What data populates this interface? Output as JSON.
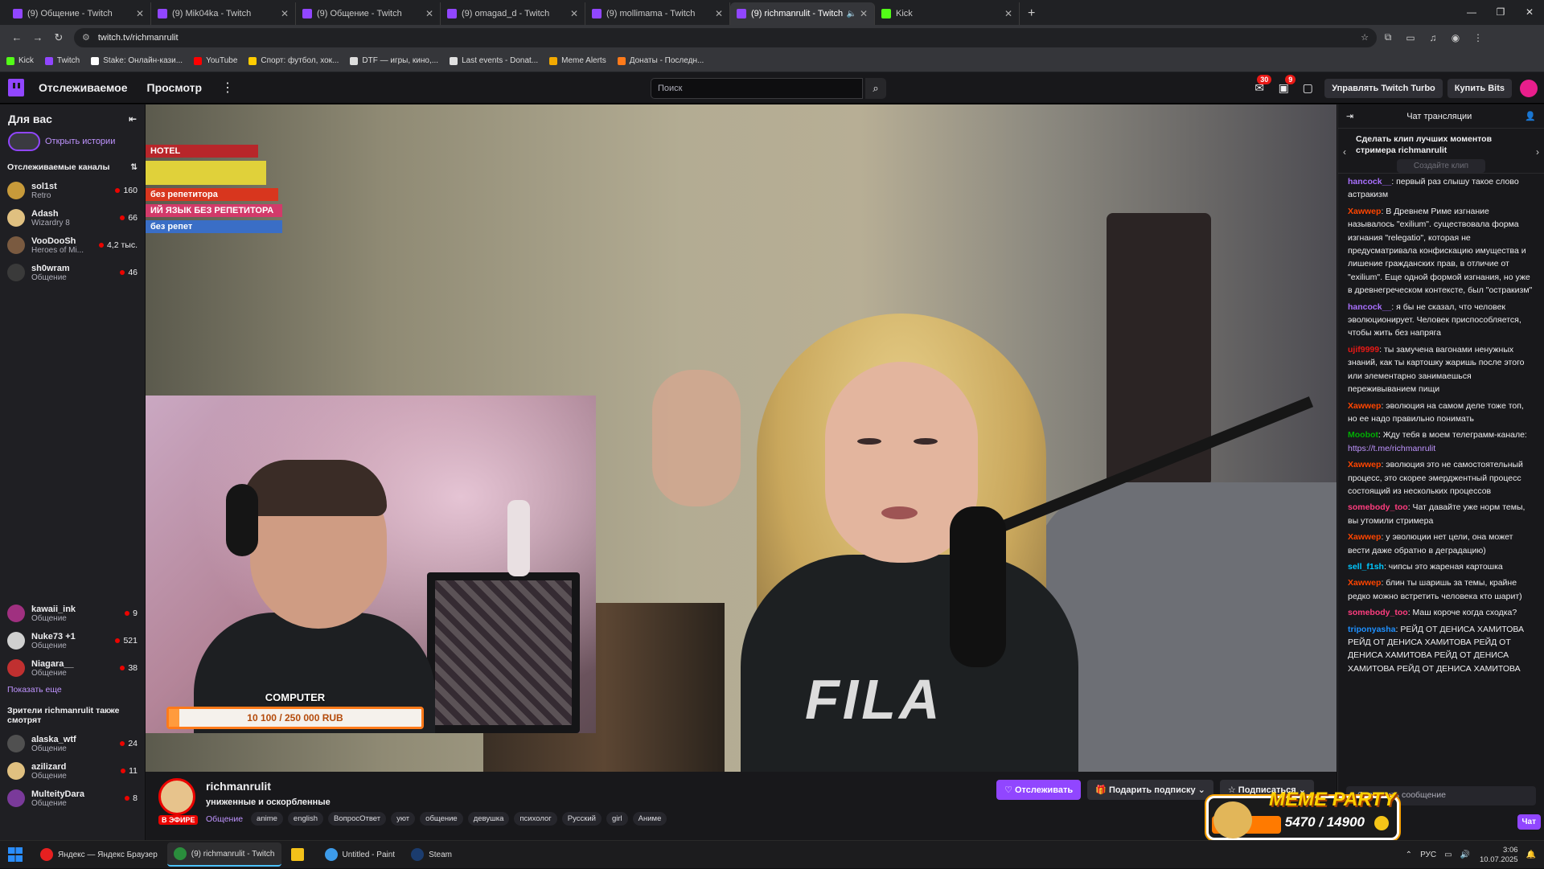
{
  "browser": {
    "tabs": [
      {
        "title": "(9) Общение - Twitch",
        "site": "twitch",
        "active": false
      },
      {
        "title": "(9) Mik04ka - Twitch",
        "site": "twitch",
        "active": false
      },
      {
        "title": "(9) Общение - Twitch",
        "site": "twitch",
        "active": false
      },
      {
        "title": "(9) omagad_d - Twitch",
        "site": "twitch",
        "active": false
      },
      {
        "title": "(9) mollimama - Twitch",
        "site": "twitch",
        "active": false
      },
      {
        "title": "(9) richmanrulit - Twitch",
        "site": "twitch",
        "active": true
      },
      {
        "title": "Kick",
        "site": "kick",
        "active": false
      }
    ],
    "url": "twitch.tv/richmanrulit",
    "bookmarks": [
      "Kick",
      "Twitch",
      "Stake: Онлайн-кази...",
      "YouTube",
      "Спорт: футбол, хок...",
      "DTF — игры, кино,...",
      "Last events - Donat...",
      "Meme Alerts",
      "Донаты - Последн..."
    ]
  },
  "twitch_nav": {
    "following": "Отслеживаемое",
    "browse": "Просмотр",
    "more": "⋮",
    "search_placeholder": "Поиск",
    "inbox_badge": "30",
    "notif_badge": "9",
    "turbo": "Управлять Twitch Turbo",
    "bits": "Купить Bits"
  },
  "sidebar": {
    "title": "Для вас",
    "stories": "Открыть истории",
    "followed_title": "Отслеживаемые каналы",
    "followed": [
      {
        "name": "sol1st",
        "game": "Retro",
        "viewers": "160",
        "color": "#c79a3a"
      },
      {
        "name": "Adash",
        "game": "Wizardry 8",
        "viewers": "66",
        "color": "#e0c080"
      },
      {
        "name": "VooDooSh",
        "game": "Heroes of Mi...",
        "viewers": "4,2 тыс.",
        "color": "#7a5a40"
      },
      {
        "name": "sh0wram",
        "game": "Общение",
        "viewers": "46",
        "color": "#3a3a3a"
      }
    ],
    "followed_more": [
      {
        "name": "kawaii_ink",
        "game": "Общение",
        "viewers": "9",
        "color": "#a03080"
      },
      {
        "name": "Nuke73 +1",
        "game": "Общение",
        "viewers": "521",
        "color": "#d0d0d0"
      },
      {
        "name": "Niagara__",
        "game": "Общение",
        "viewers": "38",
        "color": "#c03030"
      }
    ],
    "show_more": "Показать еще",
    "also_watch_title": "Зрители richmanrulit также смотрят",
    "also_watch": [
      {
        "name": "alaska_wtf",
        "game": "Общение",
        "viewers": "24",
        "color": "#505050"
      },
      {
        "name": "azilizard",
        "game": "Общение",
        "viewers": "11",
        "color": "#e0c080"
      },
      {
        "name": "MulteityDara",
        "game": "Общение",
        "viewers": "8",
        "color": "#7a3a9a"
      }
    ]
  },
  "stream": {
    "alert_title": "COMPUTER",
    "alert_progress_text": "10 100 / 250 000 RUB",
    "alert_progress": 0.04,
    "shirt_brand": "FILA",
    "books": [
      "HOTEL",
      "без репетитора",
      "ИЙ ЯЗЫК БЕЗ РЕПЕТИТОРА",
      "без репет"
    ],
    "streamer": "richmanrulit",
    "live": "В ЭФИРЕ",
    "title": "униженные и оскорбленные",
    "category": "Общение",
    "tags": [
      "anime",
      "english",
      "ВопросОтвет",
      "уют",
      "общение",
      "девушка",
      "психолог",
      "Русский",
      "girl",
      "Аниме"
    ],
    "follow": "Отслеживать",
    "gift": "Подарить подписку",
    "subscribe": "Подписаться"
  },
  "chat": {
    "header": "Чат трансляции",
    "clip_prompt": "Сделать клип лучших моментов стримера richmanrulit",
    "clip_button": "Создайте клип",
    "messages": [
      {
        "user": "hancock__",
        "color": "#a970ff",
        "text": ": первый раз слышу такое слово астракизм"
      },
      {
        "user": "Хаwwер",
        "color": "#ff4500",
        "text": ": В Древнем Риме изгнание называлось \"exilium\". существовала форма изгнания \"relegatio\", которая не предусматривала конфискацию имущества и лишение гражданских прав, в отличие от \"exilium\". Еще одной формой изгнания, но уже в древнегреческом контексте, был \"остракизм\""
      },
      {
        "user": "hancock__",
        "color": "#a970ff",
        "text": ": я бы не сказал, что человек эволюционирует. Человек приспособляется, чтобы жить без напряга"
      },
      {
        "user": "ujif9999",
        "color": "#e91916",
        "text": ": ты замучена вагонами ненужных знаний, как ты картошку жаришь после этого или элементарно занимаешься переживыванием пищи"
      },
      {
        "user": "Хаwwер",
        "color": "#ff4500",
        "text": ": эволюция на самом деле тоже топ, но ее надо правильно понимать"
      },
      {
        "user": "Moobot",
        "color": "#00ad03",
        "text": ": Жду тебя в моем телеграмм-канале: ",
        "link": "https://t.me/richmanrulit"
      },
      {
        "user": "Хаwwер",
        "color": "#ff4500",
        "text": ": эволюция это не самостоятельный процесс, это скорее эмерджентный процесс состоящий из нескольких процессов"
      },
      {
        "user": "somebody_too",
        "color": "#ff3d7f",
        "text": ": Чат давайте уже норм темы, вы утомили стримера"
      },
      {
        "user": "Хаwwер",
        "color": "#ff4500",
        "text": ": у эволюции нет цели, она может вести даже обратно в деградацию)"
      },
      {
        "user": "sell_f1sh",
        "color": "#00c8ff",
        "text": ": чипсы это жареная картошка"
      },
      {
        "user": "Хаwwер",
        "color": "#ff4500",
        "text": ": блин ты шаришь за темы, крайне редко можно встретить человека кто шарит)"
      },
      {
        "user": "somebody_too",
        "color": "#ff3d7f",
        "text": ": Маш короче когда сходка?"
      },
      {
        "user": "triponyasha",
        "color": "#1e90ff",
        "text": ": РЕЙД ОТ ДЕНИСА ХАМИТОВА РЕЙД ОТ ДЕНИСА ХАМИТОВА РЕЙД ОТ ДЕНИСА ХАМИТОВА РЕЙД ОТ ДЕНИСА ХАМИТОВА РЕЙД ОТ ДЕНИСА ХАМИТОВА"
      }
    ],
    "input_placeholder": "Отправить сообщение",
    "chat_button": "Чат"
  },
  "overlay": {
    "title": "MEME PARTY",
    "value": "5470 / 14900",
    "progress": 0.367
  },
  "taskbar": {
    "apps": [
      {
        "label": "Яндекс — Яндекс Браузер",
        "color": "#e62020",
        "active": false
      },
      {
        "label": "(9) richmanrulit - Twitch",
        "color": "#2a8d3c",
        "active": true
      },
      {
        "label": "",
        "color": "#f3c11a",
        "active": false
      },
      {
        "label": "Untitled - Paint",
        "color": "#3d9be9",
        "active": false
      },
      {
        "label": "Steam",
        "color": "#1b3c6e",
        "active": false
      }
    ],
    "lang": "РУС",
    "time": "3:06",
    "date": "10.07.2025"
  }
}
